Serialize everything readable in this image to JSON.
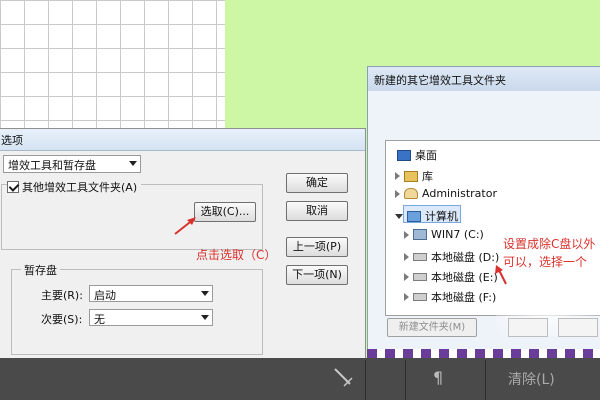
{
  "prefs_dialog": {
    "title": "选项",
    "section": "增效工具和暂存盘",
    "checkbox_label": "其他增效工具文件夹(A)",
    "choose_button": "选取(C)...",
    "scratch_legend": "暂存盘",
    "primary_label": "主要(R):",
    "primary_value": "启动",
    "secondary_label": "次要(S):",
    "secondary_value": "无",
    "ok_button": "确定",
    "cancel_button": "取消",
    "prev_button": "上一项(P)",
    "next_button": "下一项(N)"
  },
  "annotations": {
    "click_choose": "点击选取（C）",
    "hint_line1": "设置成除C盘以外",
    "hint_line2": "可以，选择一个"
  },
  "folder_dialog": {
    "title": "新建的其它增效工具文件夹",
    "tree": [
      {
        "label": "桌面",
        "icon": "desktop-icon"
      },
      {
        "label": "库",
        "icon": "library-icon"
      },
      {
        "label": "Administrator",
        "icon": "user-folder-icon"
      },
      {
        "label": "计算机",
        "icon": "computer-icon"
      },
      {
        "label": "WIN7 (C:)",
        "icon": "system-drive-icon"
      },
      {
        "label": "本地磁盘 (D:)",
        "icon": "disk-icon"
      },
      {
        "label": "本地磁盘 (E:)",
        "icon": "disk-icon"
      },
      {
        "label": "本地磁盘 (F:)",
        "icon": "disk-icon"
      }
    ],
    "new_folder_button": "新建文件夹(M)"
  },
  "bottom_bar": {
    "paragraph_glyph": "¶",
    "clear_label": "清除(L)"
  },
  "colors": {
    "green_bg": "#cdf7a4",
    "annotation_red": "#d9322e",
    "bottom_bar": "#4a4a4a"
  }
}
